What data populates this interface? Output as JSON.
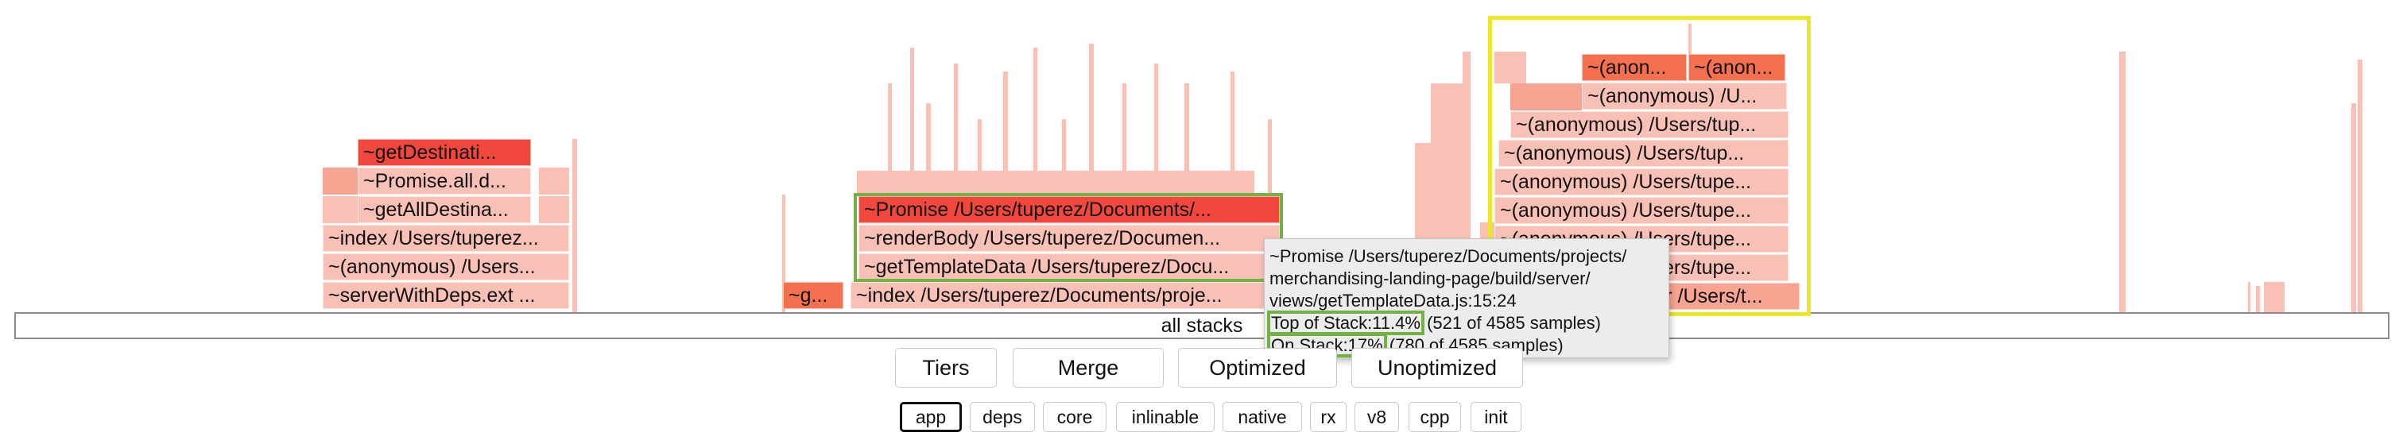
{
  "flamegraph": {
    "root_label": "all stacks",
    "frames": {
      "get_destination": "~getDestinati...",
      "promise_all": "~Promise.all.d...",
      "get_all_destina": "~getAllDestina...",
      "index_left": "~index /Users/tuperez...",
      "anonymous_left": "~(anonymous) /Users...",
      "server_with_deps": "~serverWithDeps.ext ...",
      "g_small": "~g...",
      "promise_main": "~Promise /Users/tuperez/Documents/...",
      "render_body": "~renderBody /Users/tuperez/Documen...",
      "get_template_data": "~getTemplateData /Users/tuperez/Docu...",
      "index_main": "~index /Users/tuperez/Documents/proje...",
      "anon_top_1": "~(anon...",
      "anon_top_2": "~(anon...",
      "anon_r1": "~(anonymous) /U...",
      "anon_r2": "~(anonymous) /Users/tup...",
      "anon_r3": "~(anonymous) /Users/tup...",
      "anon_r4": "~(anonymous) /Users/tupe...",
      "anon_r5": "~(anonymous) /Users/tupe...",
      "anon_r6": "~(anonymous) /Users/tupe...",
      "anon_r7": "~(anonymous) /Users/tupe...",
      "anon_r8": "rr /Users/t..."
    }
  },
  "tooltip": {
    "line1": "~Promise /Users/tuperez/Documents/projects/",
    "line2": "merchandising-landing-page/build/server/",
    "line3": "views/getTemplateData.js:15:24",
    "top_of_stack_label": "Top of Stack:11.4%",
    "top_of_stack_detail": "(521 of 4585 samples)",
    "on_stack_label": "On Stack:17%",
    "on_stack_detail": "(780 of 4585 samples)"
  },
  "controls": {
    "tiers": "Tiers",
    "merge": "Merge",
    "optimized": "Optimized",
    "unoptimized": "Unoptimized"
  },
  "filters": [
    "app",
    "deps",
    "core",
    "inlinable",
    "native",
    "rx",
    "v8",
    "cpp",
    "init"
  ],
  "colors": {
    "frame_hot": "#f2473c",
    "frame_warm": "#f4704f",
    "frame_mid": "#f7a592",
    "frame_cool": "#f9c0b5",
    "highlight_green": "#72b244",
    "highlight_yellow": "#ebe72c"
  }
}
